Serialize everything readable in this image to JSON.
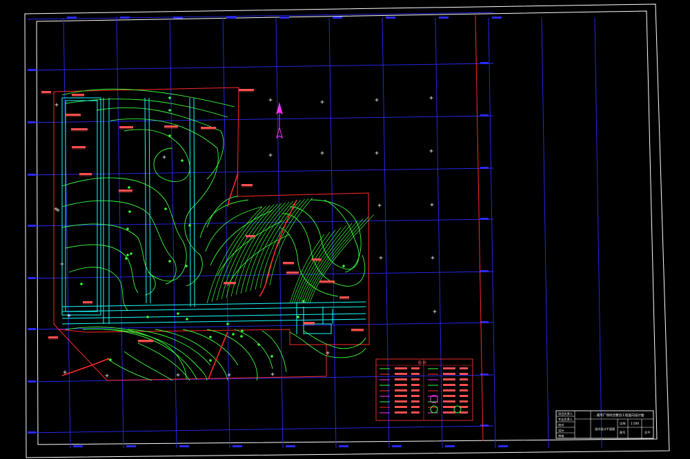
{
  "drawing": {
    "title_block": {
      "project_title": "…城市广场综合整治工程竖向设计图",
      "rows": [
        "项目负责人",
        "专业负责人",
        "校对",
        "设计",
        "审核"
      ],
      "sheet_title": "竖向设计平面图",
      "sheet_label": "图号",
      "scale_label": "比例",
      "scale_value": "1:500",
      "date_label": "日期",
      "sheet_no": "总平"
    },
    "legend": {
      "title": "图  例"
    },
    "colors": {
      "background": "#000000",
      "frame": "#ffffff",
      "grid": "#2a2aff",
      "contour": "#3cff3c",
      "boundary": "#ff2a2a",
      "structure": "#19ffff",
      "annotation": "#ff5050",
      "north_arrow": "#ff33ff"
    },
    "icons": [
      "north-arrow-icon",
      "grid-cross-marker-icon"
    ]
  }
}
